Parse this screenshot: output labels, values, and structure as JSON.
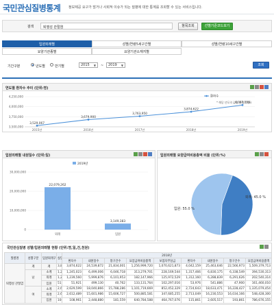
{
  "header": {
    "title": "국민관심질병통계",
    "description": "정보제공 요구가 많거나 사회적 이슈가 되는 질병에 대한 통계를 조회할 수 있는 서비스입니다."
  },
  "search": {
    "label": "검색",
    "value": "퇴행성 관절염",
    "reset_label": "항목조회",
    "code_label": "선별기준코드보기"
  },
  "tabs": [
    {
      "label": "입원외래별",
      "active": true
    },
    {
      "label": "성별/연령5세구간별",
      "active": false
    },
    {
      "label": "성별/연령10세구간별",
      "active": false
    },
    {
      "label": "요양기관종별",
      "active": false
    },
    {
      "label": "요양기관소재지별",
      "active": false
    }
  ],
  "options": {
    "period_label": "기간구분",
    "radio_year": "년도별",
    "radio_half": "반기별",
    "from": "2015",
    "tilde": "~",
    "to": "2019",
    "search_button": "조회"
  },
  "colors": {
    "brand": "#2b6fb6",
    "line": "#4a90d9",
    "bar": "#7aaee8",
    "pie_inpatient": "#9ec5ee",
    "pie_outpatient": "#3f7ec4"
  },
  "line_panel": {
    "title": "연도별 환자수 추이 (단위:명)",
    "legend": "환자수",
    "note": "* 해당 년도의 값을 클릭하세요"
  },
  "bar_panel": {
    "title": "입원외래별 내원일수 (단위:일)",
    "legend": "2019년"
  },
  "pie_panel": {
    "title": "입원외래별 요양급여비용총액 비율 (단위:%)",
    "inpatient_label": "입원: 55.0 %",
    "outpatient_label": "외래: 45.0 %"
  },
  "chart_data": [
    {
      "type": "line",
      "x": [
        "2015년",
        "2016년",
        "2017년",
        "2018년",
        "2019년"
      ],
      "series": [
        {
          "name": "환자수",
          "values": [
            3529067,
            3679900,
            3763950,
            3874622,
            4042159
          ]
        }
      ],
      "value_labels": [
        "3,529,067",
        "3,679,900",
        "3,763,950",
        "3,874,622",
        "4,042,159"
      ],
      "yticks": [
        "4,250,000",
        "4,000,000",
        "3,750,000",
        "3,500,000"
      ],
      "ylim": [
        3500000,
        4250000
      ]
    },
    {
      "type": "bar",
      "categories": [
        "외래",
        "입원"
      ],
      "series": [
        {
          "name": "2019년",
          "values": [
            22079262,
            3149383
          ]
        }
      ],
      "value_labels": [
        "22,079,262",
        "3,149,383"
      ],
      "yticks": [
        "30,000,000",
        "20,000,000",
        "10,000,000",
        "0"
      ],
      "ylim": [
        0,
        30000000
      ]
    },
    {
      "type": "pie",
      "categories": [
        "입원",
        "외래"
      ],
      "values": [
        55.0,
        45.0
      ]
    }
  ],
  "table": {
    "title": "국민관심질병 성별/입원외래별 현황 (단위:명,일,건,천원)",
    "year": "2018년",
    "header_row1": [
      "질병명",
      "성별구분",
      "입원외래구분",
      "실인원수"
    ],
    "subheads": [
      "환자수",
      "내원일수",
      "청구건수",
      "요양급여비용총액",
      "보험자부담금",
      "환자수",
      "내원일수",
      "청구건수",
      "요양급여비용총액"
    ],
    "row_head_disease": "퇴행성 관절염",
    "rows": [
      {
        "sex": "계",
        "io": "계",
        "p": "3,874",
        "a": "3,874,622",
        "b": "24,539,872",
        "c": "21,834,001",
        "d": "1,256,999,720",
        "e": "1,070,621,873",
        "f": "4,042,159",
        "g": "25,463,646",
        "h": "22,566,973",
        "i": "1,509,379,713"
      },
      {
        "sex": "남",
        "io": "소계",
        "p": "1,24",
        "a": "1,245,023",
        "b": "6,499,006",
        "c": "6,046,718",
        "d": "313,279,701",
        "e": "228,169,544",
        "f": "1,317,466",
        "g": "6,830,175",
        "h": "6,338,549",
        "i": "394,530,313"
      },
      {
        "sex": "남",
        "io": "외래",
        "p": "1,24",
        "a": "1,239,560",
        "b": "5,999,876",
        "c": "6,101,953",
        "d": "182,147,966",
        "e": "125,972,529",
        "f": "1,312,160",
        "g": "6,288,839",
        "h": "6,291,626",
        "i": "202,540,314"
      },
      {
        "sex": "남",
        "io": "입원",
        "p": "51,9",
        "a": "51,921",
        "b": "499,130",
        "c": "40,762",
        "d": "133,131,764",
        "e": "102,297,016",
        "f": "53,976",
        "g": "541,886",
        "h": "47,900",
        "i": "161,460,010"
      },
      {
        "sex": "여",
        "io": "소계",
        "p": "2,62",
        "a": "2,629,599",
        "b": "18,040,866",
        "c": "15,788,286",
        "d": "1,101,719,669",
        "e": "852,452,329",
        "f": "2,724,643",
        "g": "18,633,471",
        "h": "16,228,427",
        "i": "1,335,079,454"
      },
      {
        "sex": "여",
        "io": "외래",
        "p": "2,61",
        "a": "2,612,489",
        "b": "15,601,986",
        "c": "15,606,727",
        "d": "500,885,581",
        "e": "347,685,255",
        "f": "2,713,049",
        "g": "16,230,553",
        "h": "16,034,166",
        "i": "548,428,300"
      },
      {
        "sex": "여",
        "io": "입원",
        "p": "108,",
        "a": "108,961",
        "b": "2,448,880",
        "c": "181,559",
        "d": "640,784,588",
        "e": "464,767,076",
        "f": "115,861",
        "g": "2,605,517",
        "h": "193,861",
        "i": "786,676,155"
      }
    ]
  }
}
